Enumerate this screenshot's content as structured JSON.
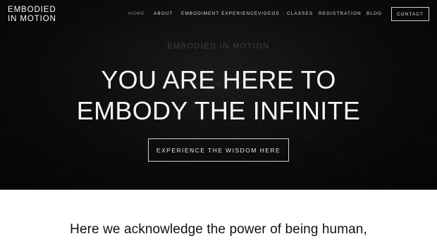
{
  "brand": {
    "line1": "EMBODIED",
    "line2": "IN MOTION"
  },
  "nav": {
    "items": [
      {
        "label": "Home",
        "active": true
      },
      {
        "label": "About"
      },
      {
        "label": "Embodiment Experience"
      },
      {
        "label": "Videos"
      },
      {
        "label": "Classes"
      },
      {
        "label": "Registration"
      },
      {
        "label": "Blog"
      }
    ],
    "contact_label": "Contact"
  },
  "hero": {
    "eyebrow": "EMBODIED IN MOTION",
    "headline_line1": "YOU ARE HERE TO",
    "headline_line2": "EMBODY THE INFINITE",
    "cta_label": "EXPERIENCE THE WISDOM HERE"
  },
  "intro": {
    "text": "Here we acknowledge the power of being human,"
  },
  "colors": {
    "hero_bg": "#0b0b0b",
    "text_light": "#f5f5f5",
    "body_text": "#111111"
  }
}
